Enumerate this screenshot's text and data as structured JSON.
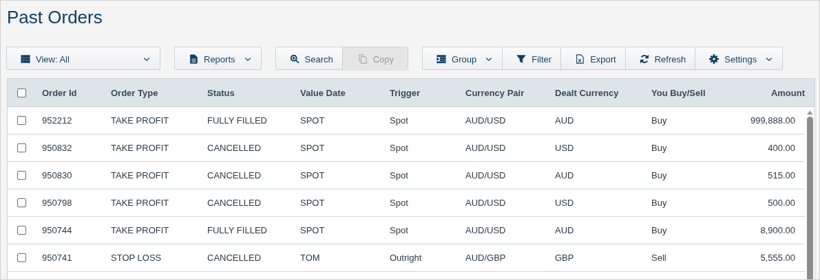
{
  "title": "Past Orders",
  "toolbar": [
    [
      {
        "label": "View: All",
        "kind": "view",
        "caret": true,
        "disabled": false
      }
    ],
    [
      {
        "label": "Reports",
        "kind": "reports",
        "caret": true,
        "disabled": false
      }
    ],
    [
      {
        "label": "Search",
        "kind": "search",
        "caret": false,
        "disabled": false
      },
      {
        "label": "Copy",
        "kind": "copy",
        "caret": false,
        "disabled": true
      }
    ],
    [
      {
        "label": "Group",
        "kind": "group",
        "caret": true,
        "disabled": false
      },
      {
        "label": "Filter",
        "kind": "filter",
        "caret": false,
        "disabled": false
      },
      {
        "label": "Export",
        "kind": "export",
        "caret": false,
        "disabled": false
      },
      {
        "label": "Refresh",
        "kind": "refresh",
        "caret": false,
        "disabled": false
      },
      {
        "label": "Settings",
        "kind": "settings",
        "caret": true,
        "disabled": false
      }
    ]
  ],
  "table": {
    "select_all_checked": false,
    "columns": [
      "Order Id",
      "Order Type",
      "Status",
      "Value Date",
      "Trigger",
      "Currency Pair",
      "Dealt Currency",
      "You Buy/Sell",
      "Amount"
    ],
    "rows": [
      {
        "checked": false,
        "cells": [
          "952212",
          "TAKE PROFIT",
          "FULLY FILLED",
          "SPOT",
          "Spot",
          "AUD/USD",
          "AUD",
          "Buy",
          "999,888.00"
        ]
      },
      {
        "checked": false,
        "cells": [
          "950832",
          "TAKE PROFIT",
          "CANCELLED",
          "SPOT",
          "Spot",
          "AUD/USD",
          "USD",
          "Buy",
          "400.00"
        ]
      },
      {
        "checked": false,
        "cells": [
          "950830",
          "TAKE PROFIT",
          "CANCELLED",
          "SPOT",
          "Spot",
          "AUD/USD",
          "AUD",
          "Buy",
          "515.00"
        ]
      },
      {
        "checked": false,
        "cells": [
          "950798",
          "TAKE PROFIT",
          "CANCELLED",
          "SPOT",
          "Spot",
          "AUD/USD",
          "USD",
          "Buy",
          "500.00"
        ]
      },
      {
        "checked": false,
        "cells": [
          "950744",
          "TAKE PROFIT",
          "FULLY FILLED",
          "SPOT",
          "Spot",
          "AUD/USD",
          "AUD",
          "Buy",
          "8,900.00"
        ]
      },
      {
        "checked": false,
        "cells": [
          "950741",
          "STOP LOSS",
          "CANCELLED",
          "TOM",
          "Outright",
          "AUD/GBP",
          "GBP",
          "Sell",
          "5,555.00"
        ]
      }
    ]
  }
}
